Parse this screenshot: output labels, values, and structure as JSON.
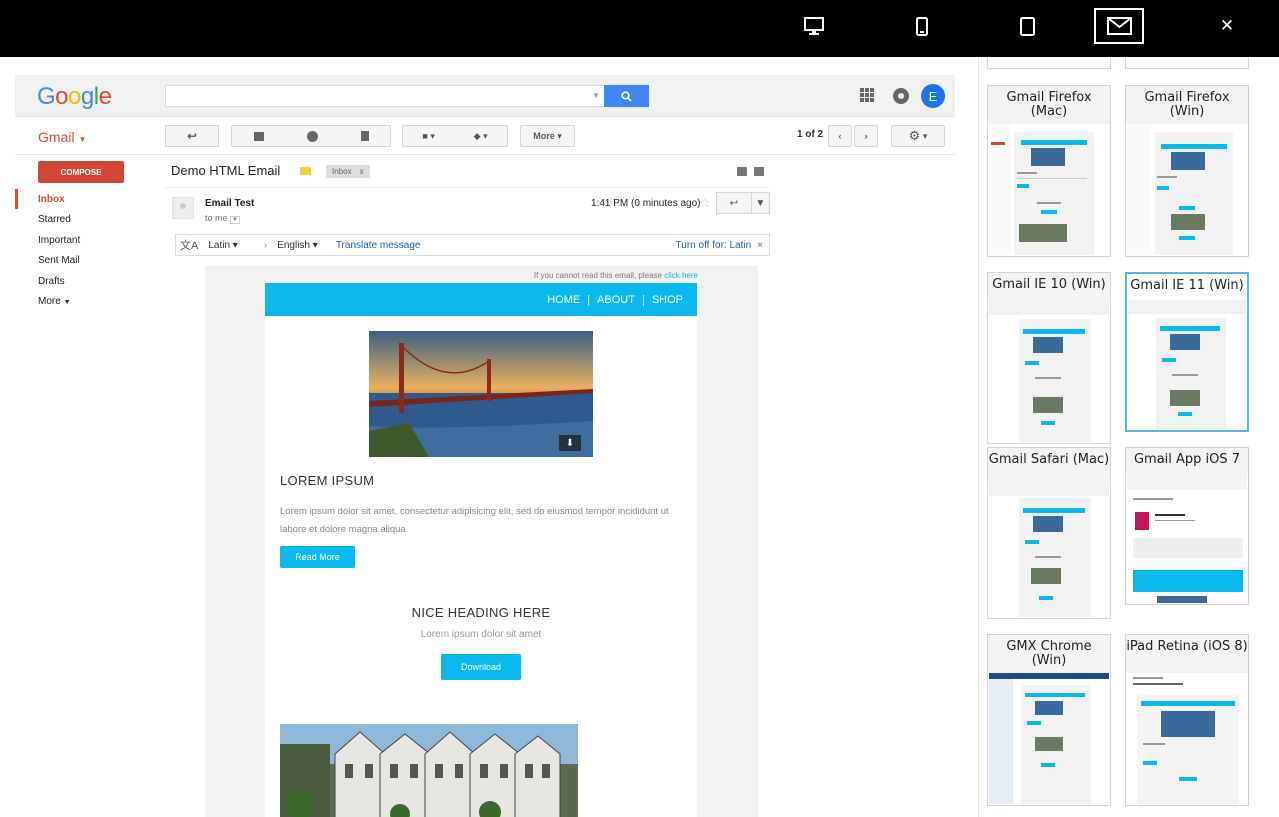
{
  "topbar": {
    "buttons": [
      {
        "name": "desktop-view",
        "icon": "desktop-icon"
      },
      {
        "name": "mobile-view",
        "icon": "phone-icon"
      },
      {
        "name": "tablet-view",
        "icon": "tablet-icon"
      },
      {
        "name": "email-view",
        "icon": "envelope-icon",
        "active": true
      },
      {
        "name": "close",
        "icon": "close-icon",
        "label": "✕"
      }
    ]
  },
  "gmail": {
    "logo": "Google",
    "brand": "Gmail",
    "avatar_letter": "E",
    "toolbar": {
      "more_label": "More",
      "pager": "1 of 2"
    },
    "compose_label": "COMPOSE",
    "nav": [
      "Inbox",
      "Starred",
      "Important",
      "Sent Mail",
      "Drafts",
      "More"
    ],
    "subject": "Demo HTML Email",
    "inbox_tag": "Inbox",
    "inbox_tag_close": "x",
    "sender": "Email Test",
    "to": "to me",
    "time": "1:41 PM (0 minutes ago)",
    "translate": {
      "from": "Latin",
      "to": "English",
      "translate_link": "Translate message",
      "turn_off": "Turn off for: Latin"
    }
  },
  "email": {
    "cannot_read": "If you cannot read this email, please",
    "click_here": "click here",
    "nav": {
      "home": "HOME",
      "about": "ABOUT",
      "shop": "SHOP",
      "sep": "|"
    },
    "heading1": "LOREM IPSUM",
    "paragraph1": "Lorem ipsum dolor sit amet, consectetur adipisicing elit, sed do eiusmod tempor incididunt ut labore et dolore magna aliqua",
    "read_more": "Read More",
    "heading2": "NICE HEADING HERE",
    "paragraph2": "Lorem ipsum dolor sit amet",
    "download": "Download"
  },
  "previews": [
    {
      "label": "Gmail Firefox (Mac)"
    },
    {
      "label": "Gmail Firefox (Win)"
    },
    {
      "label": "Gmail IE 10 (Win)"
    },
    {
      "label": "Gmail IE 11 (Win)",
      "active": true
    },
    {
      "label": "Gmail Safari (Mac)"
    },
    {
      "label": "Gmail App iOS 7"
    },
    {
      "label": "GMX Chrome (Win)"
    },
    {
      "label": "iPad Retina (iOS 8)"
    }
  ],
  "colors": {
    "accent": "#0ab8ed",
    "gmail_red": "#dd4b39",
    "google_blue": "#4285f4"
  }
}
